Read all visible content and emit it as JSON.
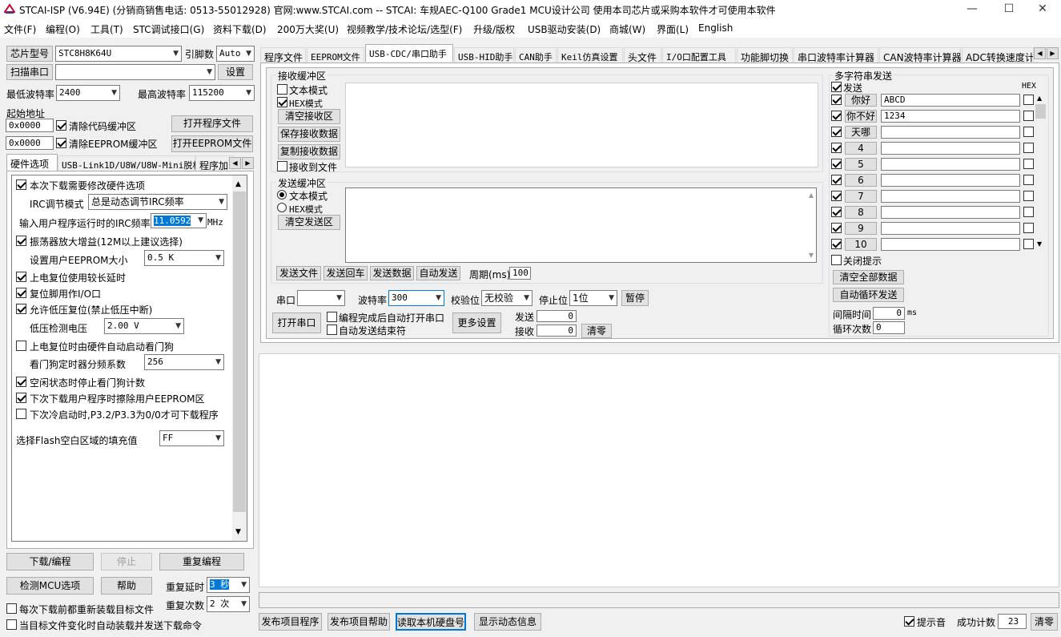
{
  "title": "STCAI-ISP (V6.94E) (分销商销售电话: 0513-55012928) 官网:www.STCAI.com  -- STCAI: 车规AEC-Q100 Grade1 MCU设计公司 使用本司芯片或采购本软件才可使用本软件",
  "menu": [
    "文件(F)",
    "编程(O)",
    "工具(T)",
    "STC调试接口(G)",
    "资料下载(D)",
    "200万大奖(U)",
    "视频教学/技术论坛/选型(F)",
    "升级/版权",
    "USB驱动安装(D)",
    "商城(W)",
    "界面(L)",
    "English"
  ],
  "left": {
    "chip_btn": "芯片型号",
    "chip_value": "STC8H8K64U",
    "pins_label": "引脚数",
    "pins_value": "Auto",
    "scan_btn": "扫描串口",
    "scan_value": "",
    "settings_btn": "设置",
    "min_baud_label": "最低波特率",
    "min_baud": "2400",
    "max_baud_label": "最高波特率",
    "max_baud": "115200",
    "start_addr_label": "起始地址",
    "addr1": "0x0000",
    "clear_code": "清除代码缓冲区",
    "open_prog": "打开程序文件",
    "addr2": "0x0000",
    "clear_eeprom": "清除EEPROM缓冲区",
    "open_eeprom": "打开EEPROM文件",
    "tabs": [
      "硬件选项",
      "USB-Link1D/U8W/U8W-Mini脱机",
      "程序加"
    ],
    "hw": {
      "opt1": "本次下载需要修改硬件选项",
      "irc_mode_label": "IRC调节模式",
      "irc_mode": "总是动态调节IRC频率",
      "irc_freq_label": "输入用户程序运行时的IRC频率",
      "irc_freq": "11.0592",
      "mhz": "MHz",
      "opt_osc": "振荡器放大增益(12M以上建议选择)",
      "eeprom_size_label": "设置用户EEPROM大小",
      "eeprom_size": "0.5 K",
      "opt_por": "上电复位使用较长延时",
      "opt_reset_io": "复位脚用作I/O口",
      "opt_lvr": "允许低压复位(禁止低压中断)",
      "lv_label": "低压检测电压",
      "lv_value": "2.00 V",
      "opt_wdt": "上电复位时由硬件自动启动看门狗",
      "wdt_div_label": "看门狗定时器分频系数",
      "wdt_div": "256",
      "opt_idle_wdt": "空闲状态时停止看门狗计数",
      "opt_erase_eeprom": "下次下载用户程序时擦除用户EEPROM区",
      "opt_cold": "下次冷启动时,P3.2/P3.3为0/0才可下载程序",
      "fill_label": "选择Flash空白区域的填充值",
      "fill_value": "FF"
    },
    "download_btn": "下载/编程",
    "stop_btn": "停止",
    "reprog_btn": "重复编程",
    "detect_btn": "检测MCU选项",
    "help_btn": "帮助",
    "repeat_delay_label": "重复延时",
    "repeat_delay": "3 秒",
    "repeat_count_label": "重复次数",
    "repeat_count": "2 次",
    "reload_each": "每次下载前都重新装载目标文件",
    "auto_reload": "当目标文件变化时自动装载并发送下载命令"
  },
  "right": {
    "tabs": [
      "程序文件",
      "EEPROM文件",
      "USB-CDC/串口助手",
      "USB-HID助手",
      "CAN助手",
      "Keil仿真设置",
      "头文件",
      "I/O口配置工具",
      "功能脚切换",
      "串口波特率计算器",
      "CAN波特率计算器",
      "ADC转换速度计算"
    ],
    "recv": {
      "title": "接收缓冲区",
      "text_mode": "文本模式",
      "hex_mode": "HEX模式",
      "clear": "清空接收区",
      "save": "保存接收数据",
      "copy": "复制接收数据",
      "to_file": "接收到文件"
    },
    "send": {
      "title": "发送缓冲区",
      "text_mode": "文本模式",
      "hex_mode": "HEX模式",
      "clear": "清空发送区",
      "send_file": "发送文件",
      "send_enter": "发送回车",
      "send_data": "发送数据",
      "auto_send": "自动发送",
      "period_label": "周期(ms)",
      "period": "100"
    },
    "serial": {
      "port_label": "串口",
      "port": "",
      "baud_label": "波特率",
      "baud": "300",
      "parity_label": "校验位",
      "parity": "无校验",
      "stop_label": "停止位",
      "stop": "1位",
      "pause": "暂停",
      "open": "打开串口",
      "auto_open": "编程完成后自动打开串口",
      "auto_end": "自动发送结束符",
      "more": "更多设置",
      "sent_label": "发送",
      "sent": "0",
      "recv_label": "接收",
      "recv": "0",
      "clear": "清零"
    },
    "multi": {
      "title": "多字符串发送",
      "send_col": "发送",
      "hex_col": "HEX",
      "rows": [
        {
          "label": "你好",
          "value": "ABCD"
        },
        {
          "label": "你不好",
          "value": "1234"
        },
        {
          "label": "天哪",
          "value": ""
        },
        {
          "label": "4",
          "value": ""
        },
        {
          "label": "5",
          "value": ""
        },
        {
          "label": "6",
          "value": ""
        },
        {
          "label": "7",
          "value": ""
        },
        {
          "label": "8",
          "value": ""
        },
        {
          "label": "9",
          "value": ""
        },
        {
          "label": "10",
          "value": ""
        }
      ],
      "close_hint": "关闭提示",
      "clear_all": "清空全部数据",
      "auto_loop": "自动循环发送",
      "interval_label": "间隔时间",
      "interval": "0",
      "ms": "ms",
      "loop_label": "循环次数",
      "loop": "0"
    }
  },
  "bottom": {
    "publish_prog": "发布项目程序",
    "publish_help": "发布项目帮助",
    "read_disk": "读取本机硬盘号",
    "show_dyn": "显示动态信息",
    "beep": "提示音",
    "success_label": "成功计数",
    "success": "23",
    "clear": "清零"
  }
}
